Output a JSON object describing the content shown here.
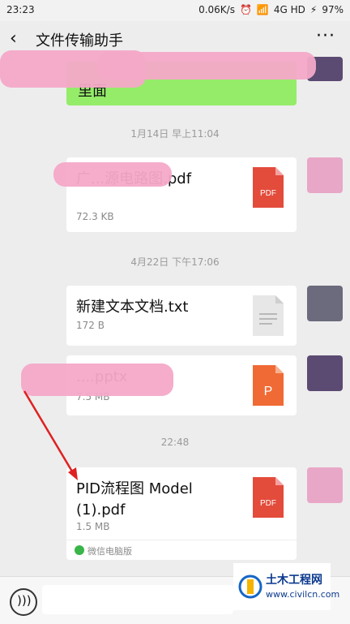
{
  "status_bar": {
    "time": "23:23",
    "net_speed": "0.06K/s",
    "network": "4G HD",
    "battery": "97%"
  },
  "nav": {
    "title": "文件传输助手",
    "back_icon": "chevron-left-icon",
    "more_icon": "ellipsis-icon"
  },
  "messages": {
    "green_text": "里面",
    "ts1": "1月14日 早上11:04",
    "file1": {
      "name": "广...源电路图.pdf",
      "size": "72.3 KB",
      "type": "PDF"
    },
    "ts2": "4月22日 下午17:06",
    "file2": {
      "name": "新建文本文档.txt",
      "size": "172 B",
      "type": "TXT"
    },
    "file3": {
      "name": "....pptx",
      "size": "7.5 MB",
      "type": "P"
    },
    "ts3": "22:48",
    "file4": {
      "name": "PID流程图 Model (1).pdf",
      "size": "1.5 MB",
      "type": "PDF",
      "footer": "微信电脑版"
    }
  },
  "input": {
    "voice_icon": "voice-icon"
  },
  "watermark": {
    "title": "土木工程网",
    "url": "www.civilcn.com"
  },
  "colors": {
    "green_bubble": "#95ec69",
    "pdf_red": "#e34b3b",
    "ppt_orange": "#f06a35",
    "accent_blue": "#0b3a8e"
  }
}
